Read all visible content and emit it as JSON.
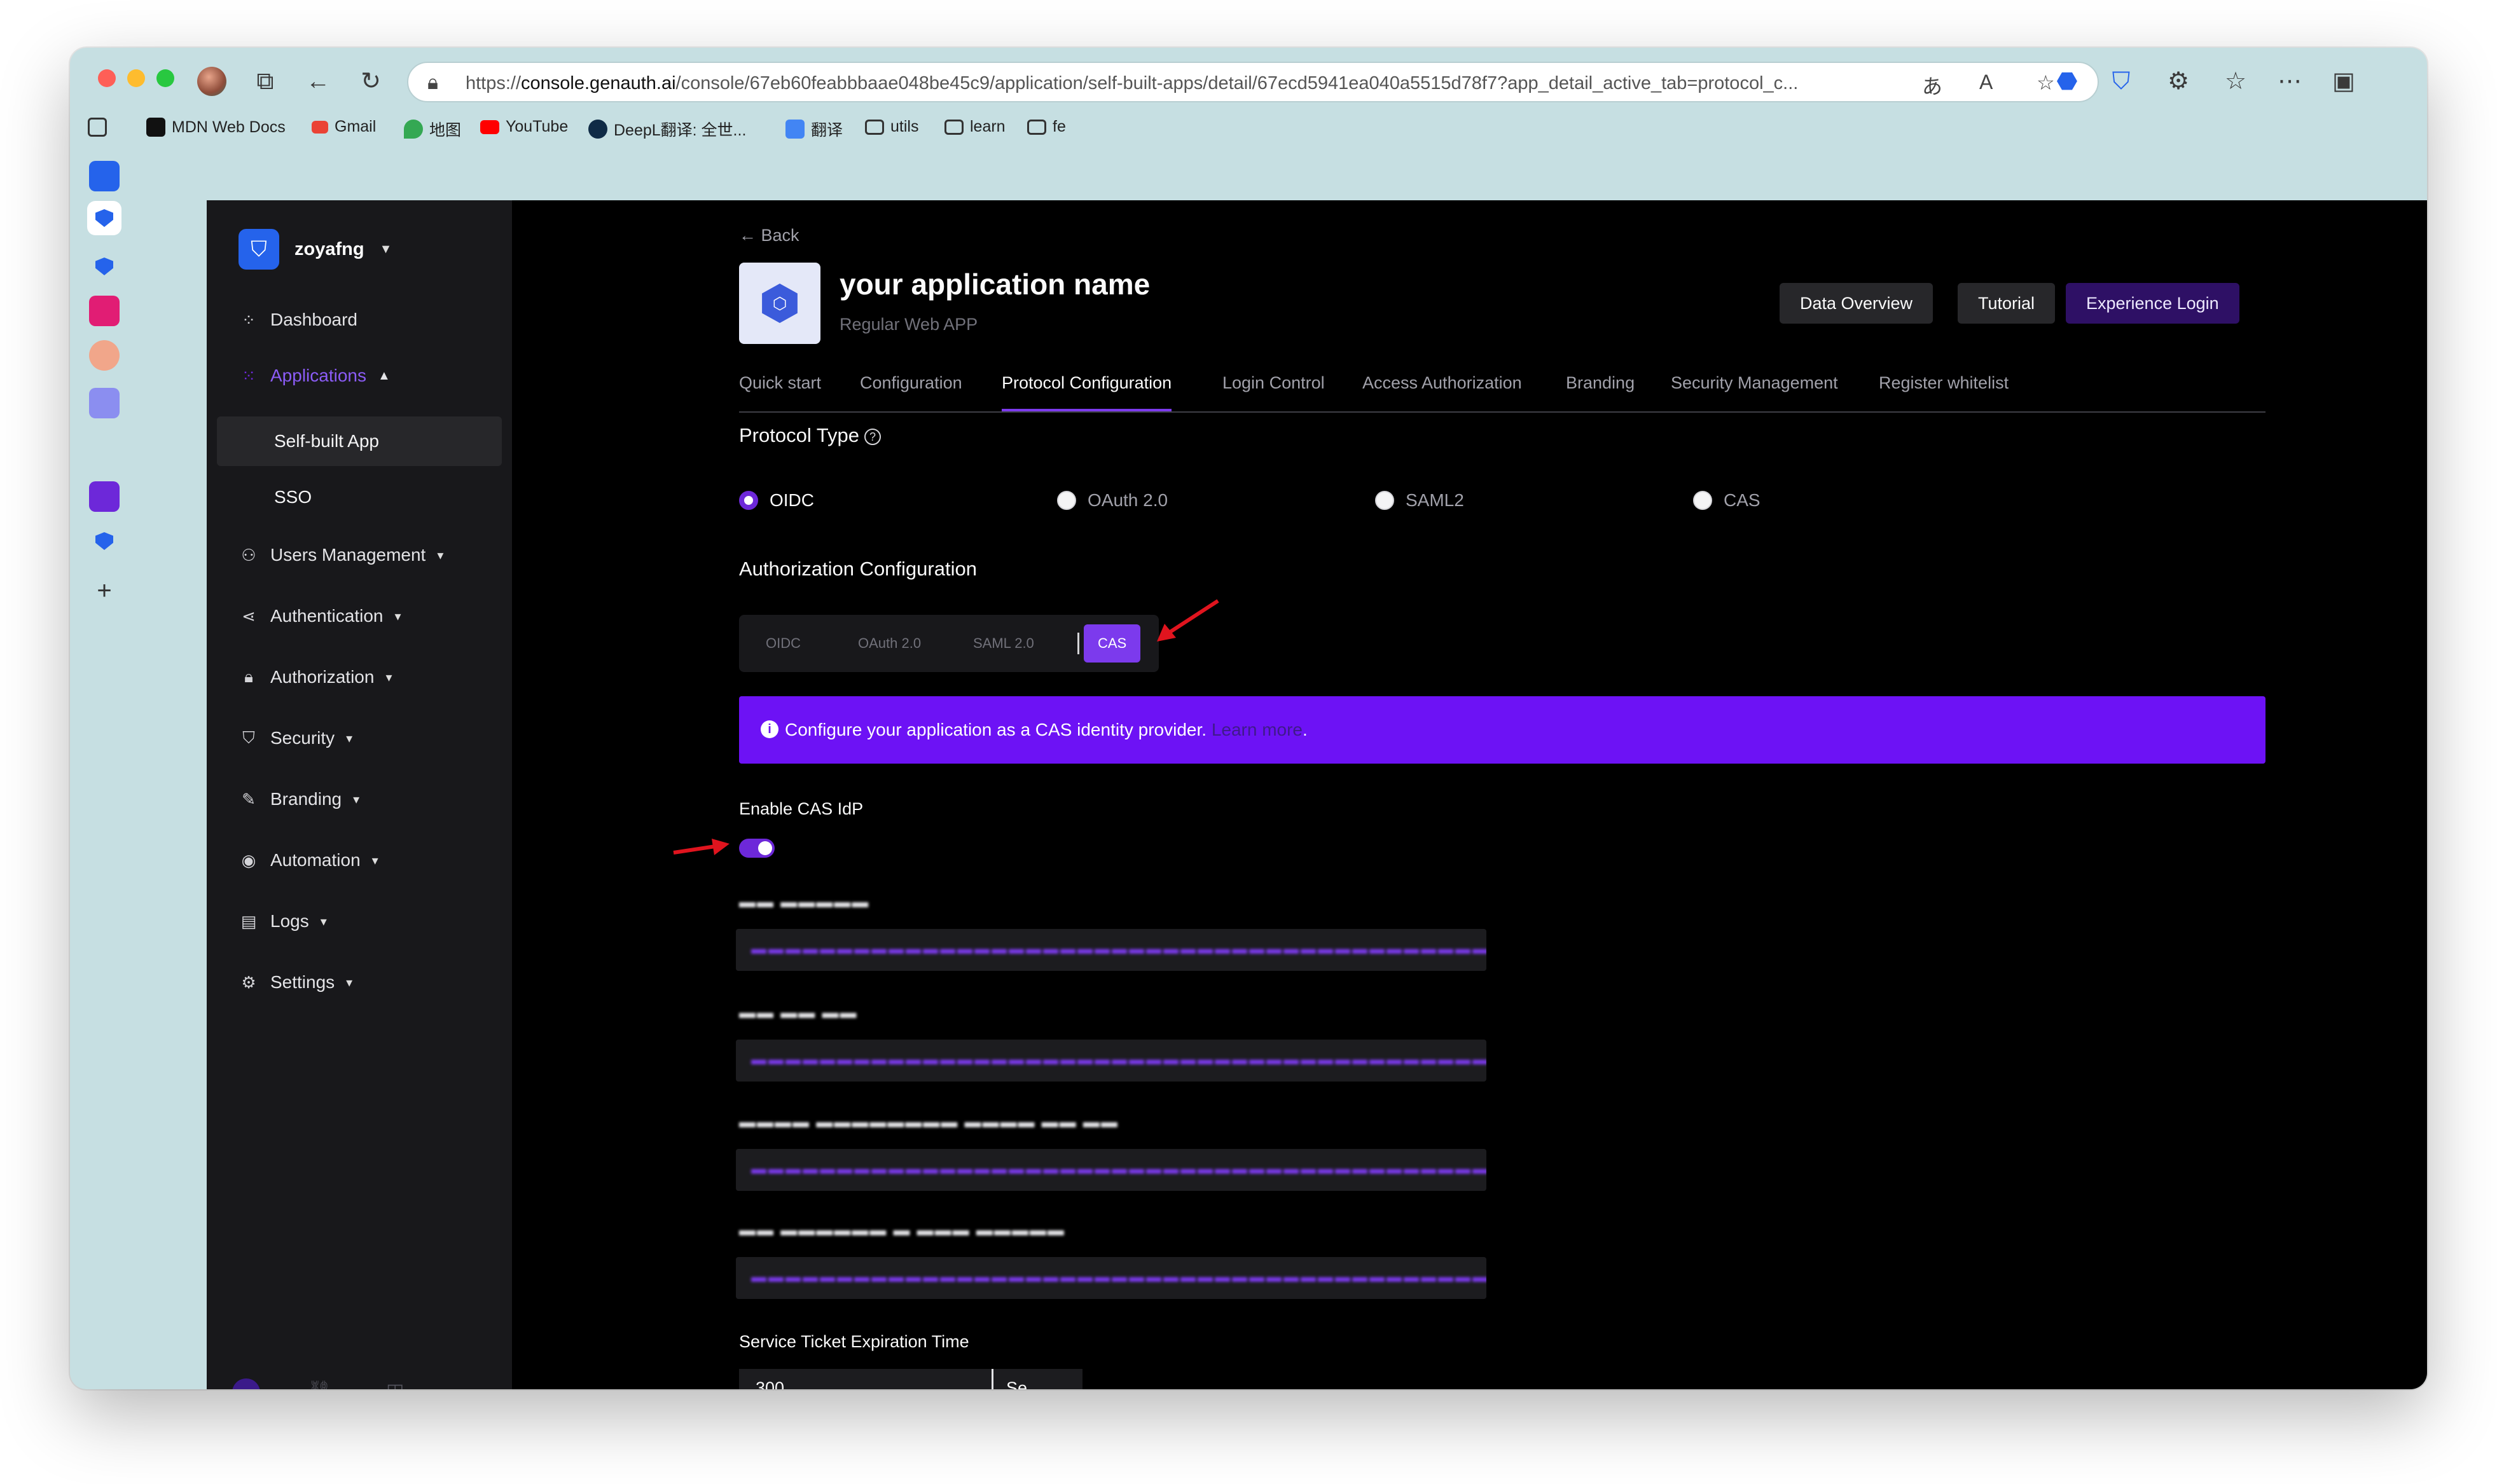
{
  "browser": {
    "url_prefix": "https://",
    "url_host": "console.genauth.ai",
    "url_path": "/console/67eb60feabbbaae048be45c9/application/self-built-apps/detail/67ecd5941ea040a5515d78f7?app_detail_active_tab=protocol_c...",
    "bookmarks": [
      "MDN Web Docs",
      "Gmail",
      "地图",
      "YouTube",
      "DeepL翻译: 全世...",
      "翻译",
      "utils",
      "learn",
      "fe"
    ]
  },
  "sidebar": {
    "org_name": "zoyafng",
    "items": [
      {
        "label": "Dashboard",
        "icon": "grid-icon"
      },
      {
        "label": "Applications",
        "icon": "apps-icon"
      },
      {
        "label": "Users Management",
        "icon": "user-icon"
      },
      {
        "label": "Authentication",
        "icon": "share-icon"
      },
      {
        "label": "Authorization",
        "icon": "lock-icon"
      },
      {
        "label": "Security",
        "icon": "shield-icon"
      },
      {
        "label": "Branding",
        "icon": "brush-icon"
      },
      {
        "label": "Automation",
        "icon": "automation-icon"
      },
      {
        "label": "Logs",
        "icon": "log-icon"
      },
      {
        "label": "Settings",
        "icon": "gear-icon"
      }
    ],
    "sub_items": [
      "Self-built App",
      "SSO"
    ]
  },
  "header": {
    "back": "Back",
    "title": "your application name",
    "subtitle": "Regular Web APP",
    "buttons": [
      "Data Overview",
      "Tutorial",
      "Experience Login"
    ]
  },
  "tabs": [
    "Quick start",
    "Configuration",
    "Protocol Configuration",
    "Login Control",
    "Access Authorization",
    "Branding",
    "Security Management",
    "Register whitelist"
  ],
  "protocol": {
    "title": "Protocol Type",
    "options": [
      "OIDC",
      "OAuth 2.0",
      "SAML2",
      "CAS"
    ],
    "selected": "OIDC"
  },
  "auth_config": {
    "title": "Authorization Configuration",
    "segments": [
      "OIDC",
      "OAuth 2.0",
      "SAML 2.0",
      "CAS"
    ],
    "active_segment": "CAS",
    "banner_text": "Configure your application as a CAS identity provider.",
    "banner_link": "Learn more",
    "banner_end": "."
  },
  "cas": {
    "enable_label": "Enable CAS IdP",
    "enabled": true,
    "expiry_label": "Service Ticket Expiration Time",
    "expiry_value": "300",
    "expiry_unit": "Se..."
  },
  "colors": {
    "accent": "#6d28d9",
    "banner": "#6d12f5",
    "background": "#000000",
    "sidebar": "#18181b"
  }
}
